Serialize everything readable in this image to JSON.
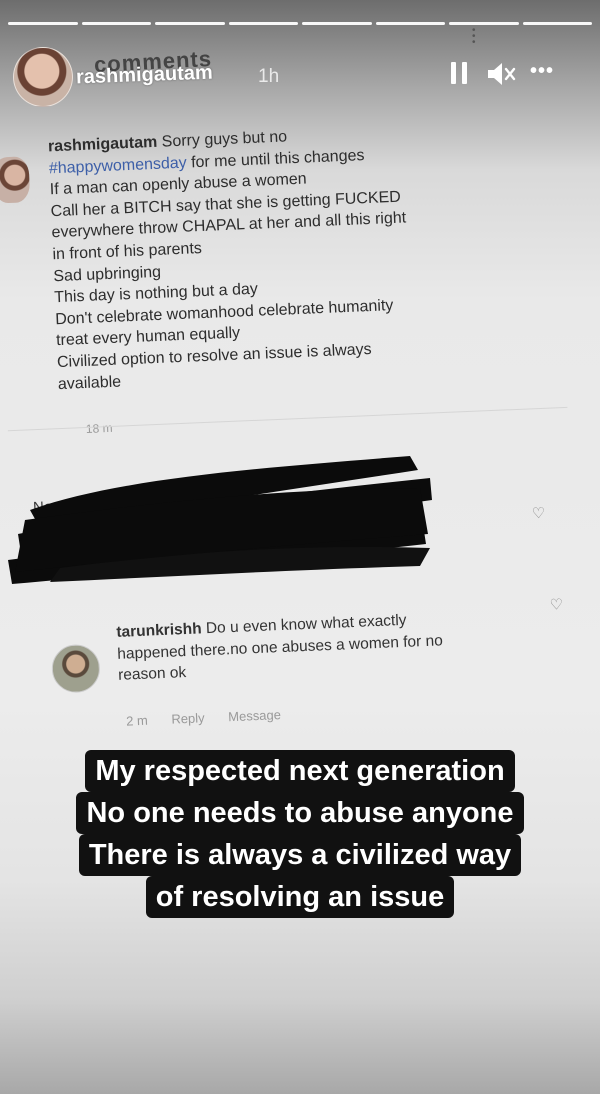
{
  "story": {
    "progress_segments": 8,
    "header": {
      "ghost_text": "comments",
      "username": "rashmigautam",
      "time": "1h",
      "controls": [
        "pause-icon",
        "mute-icon",
        "more-icon"
      ]
    }
  },
  "comment": {
    "username": "rashmigautam",
    "first_line": "Sorry guys but no",
    "hashtag": "#happywomensday",
    "hashtag_rest": "for me until this changes",
    "lines": [
      "If a man can openly abuse a women",
      "Call her a BITCH say that she is getting FUCKED",
      "everywhere throw CHAPAL at her and all this right",
      "in front of his parents",
      "Sad upbringing",
      "This day is nothing but a day",
      "Don't celebrate womanhood celebrate humanity",
      "treat every human equally",
      "Civilized option to resolve an issue is always",
      "available"
    ],
    "age": "18 m"
  },
  "sort_label": "Newest first",
  "reply": {
    "username": "tarunkrishh",
    "text_lines": [
      "Do u even know what exactly",
      "happened there.no one abuses a women for no",
      "reason ok"
    ],
    "age": "2 m",
    "reply_label": "Reply",
    "message_label": "Message"
  },
  "caption": [
    "My respected next generation",
    "No one needs to abuse anyone",
    "There is always a civilized way",
    "of resolving an issue"
  ]
}
